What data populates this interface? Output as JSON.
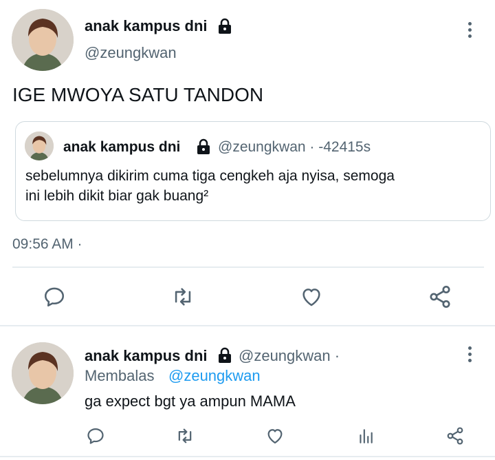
{
  "tweet": {
    "author_name": "anak kampus dni",
    "author_handle": "@zeungkwan",
    "text": "IGE MWOYA SATU TANDON",
    "time": "09:56 AM ·",
    "quoted": {
      "author_name": "anak kampus dni",
      "meta": "@zeungkwan · -42415s",
      "text_line1": "sebelumnya dikirim cuma tiga cengkeh aja nyisa, semoga",
      "text_line2": "ini lebih dikit biar gak buang²"
    },
    "actions": [
      "reply-icon",
      "retweet-icon",
      "like-icon",
      "share-icon"
    ]
  },
  "reply": {
    "author_name": "anak kampus dni",
    "author_handle": "@zeungkwan ·",
    "replying_prefix": "Membalas",
    "replying_to": "@zeungkwan",
    "text": "ga expect bgt ya ampun MAMA",
    "actions": [
      "reply-icon",
      "retweet-icon",
      "like-icon",
      "analytics-icon",
      "share-icon"
    ]
  },
  "colors": {
    "text": "#0f1419",
    "secondary": "#536471",
    "link": "#1d9bf0",
    "divider": "#e6ecf0"
  }
}
